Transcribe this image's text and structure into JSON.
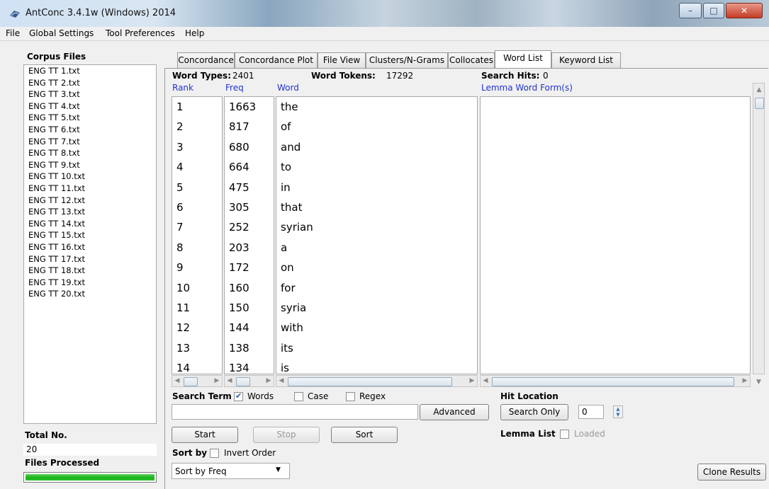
{
  "window": {
    "title": "AntConc 3.4.1w (Windows) 2014",
    "min_glyph": "–",
    "max_glyph": "□",
    "close_glyph": "✕"
  },
  "menu": [
    "File",
    "Global Settings",
    "Tool Preferences",
    "Help"
  ],
  "left_panel": {
    "corpus_files_label": "Corpus Files",
    "files": [
      "ENG TT 1.txt",
      "ENG TT 2.txt",
      "ENG TT 3.txt",
      "ENG TT 4.txt",
      "ENG TT 5.txt",
      "ENG TT 6.txt",
      "ENG TT 7.txt",
      "ENG TT 8.txt",
      "ENG TT 9.txt",
      "ENG TT 10.txt",
      "ENG TT 11.txt",
      "ENG TT 12.txt",
      "ENG TT 13.txt",
      "ENG TT 14.txt",
      "ENG TT 15.txt",
      "ENG TT 16.txt",
      "ENG TT 17.txt",
      "ENG TT 18.txt",
      "ENG TT 19.txt",
      "ENG TT 20.txt"
    ],
    "total_label": "Total No.",
    "total_value": "20",
    "files_processed_label": "Files Processed",
    "progress": 1.0
  },
  "tabs": [
    "Concordance",
    "Concordance Plot",
    "File View",
    "Clusters/N-Grams",
    "Collocates",
    "Word List",
    "Keyword List"
  ],
  "active_tab": "Word List",
  "stats": {
    "word_types_label": "Word Types:",
    "word_types_value": "2401",
    "word_tokens_label": "Word Tokens:",
    "word_tokens_value": "17292",
    "search_hits_label": "Search Hits:",
    "search_hits_value": "0"
  },
  "columns": {
    "rank": "Rank",
    "freq": "Freq",
    "word": "Word",
    "lemma": "Lemma Word Form(s)"
  },
  "rows": [
    {
      "rank": "1",
      "freq": "1663",
      "word": "the"
    },
    {
      "rank": "2",
      "freq": "817",
      "word": "of"
    },
    {
      "rank": "3",
      "freq": "680",
      "word": "and"
    },
    {
      "rank": "4",
      "freq": "664",
      "word": "to"
    },
    {
      "rank": "5",
      "freq": "475",
      "word": "in"
    },
    {
      "rank": "6",
      "freq": "305",
      "word": "that"
    },
    {
      "rank": "7",
      "freq": "252",
      "word": "syrian"
    },
    {
      "rank": "8",
      "freq": "203",
      "word": "a"
    },
    {
      "rank": "9",
      "freq": "172",
      "word": "on"
    },
    {
      "rank": "10",
      "freq": "160",
      "word": "for"
    },
    {
      "rank": "11",
      "freq": "150",
      "word": "syria"
    },
    {
      "rank": "12",
      "freq": "144",
      "word": "with"
    },
    {
      "rank": "13",
      "freq": "138",
      "word": "its"
    },
    {
      "rank": "14",
      "freq": "134",
      "word": "is"
    }
  ],
  "search": {
    "term_label": "Search Term",
    "words_label": "Words",
    "words_checked": true,
    "case_label": "Case",
    "case_checked": false,
    "regex_label": "Regex",
    "regex_checked": false,
    "input_value": "",
    "advanced_label": "Advanced"
  },
  "hit_location": {
    "label": "Hit Location",
    "search_only_label": "Search Only",
    "spinner_value": "0"
  },
  "buttons": {
    "start": "Start",
    "stop": "Stop",
    "sort": "Sort",
    "clone": "Clone Results"
  },
  "lemma_list": {
    "label": "Lemma List",
    "loaded_label": "Loaded"
  },
  "sort": {
    "label": "Sort by",
    "invert_label": "Invert Order",
    "selected": "Sort by Freq"
  }
}
